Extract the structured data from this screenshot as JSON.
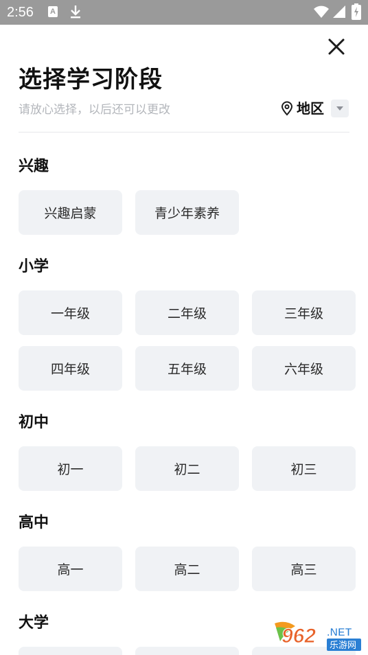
{
  "status_bar": {
    "time": "2:56",
    "icons": [
      "a-notification-icon",
      "download-icon",
      "wifi-icon",
      "cell-signal-icon",
      "battery-charging-icon"
    ]
  },
  "header": {
    "title": "选择学习阶段",
    "subtitle": "请放心选择，以后还可以更改",
    "region_label": "地区"
  },
  "sections": [
    {
      "title": "兴趣",
      "items": [
        "兴趣启蒙",
        "青少年素养"
      ]
    },
    {
      "title": "小学",
      "items": [
        "一年级",
        "二年级",
        "三年级",
        "四年级",
        "五年级",
        "六年级"
      ]
    },
    {
      "title": "初中",
      "items": [
        "初一",
        "初二",
        "初三"
      ]
    },
    {
      "title": "高中",
      "items": [
        "高一",
        "高二",
        "高三"
      ]
    },
    {
      "title": "大学",
      "items": [
        "",
        "",
        ""
      ]
    }
  ],
  "watermark": {
    "logo_text": "962",
    "tld": ".NET",
    "cn": "乐游网"
  },
  "colors": {
    "chip_bg": "#f0f2f5",
    "status_bar": "#9a9a9a",
    "subtitle": "#b3b6bb"
  }
}
